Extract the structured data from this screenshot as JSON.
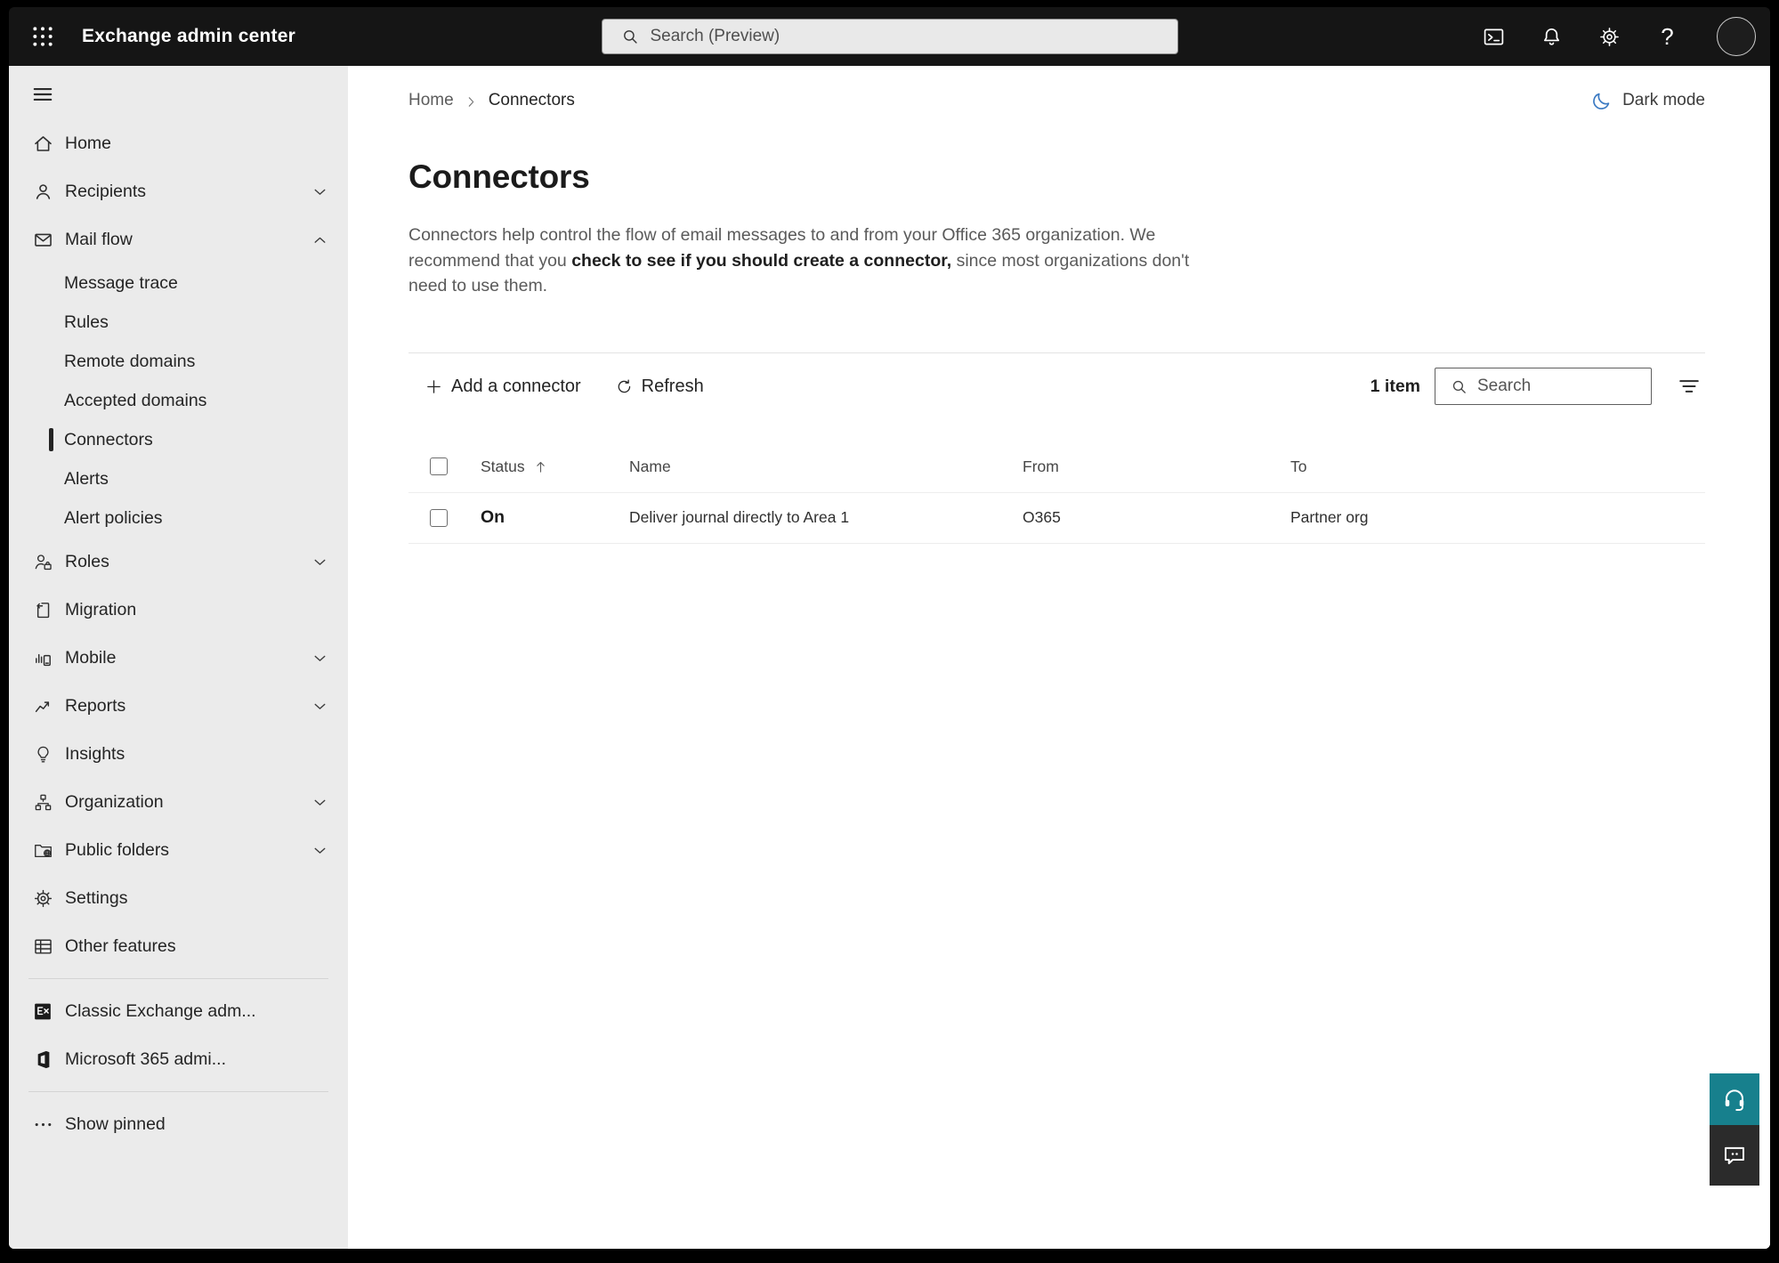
{
  "topbar": {
    "app_title": "Exchange admin center",
    "search_placeholder": "Search (Preview)"
  },
  "sidebar": {
    "items": [
      {
        "type": "item",
        "label": "Home",
        "icon": "home"
      },
      {
        "type": "item",
        "label": "Recipients",
        "icon": "recipients",
        "chevron": "down"
      },
      {
        "type": "item",
        "label": "Mail flow",
        "icon": "mail-flow",
        "chevron": "up"
      },
      {
        "type": "sub",
        "label": "Message trace"
      },
      {
        "type": "sub",
        "label": "Rules"
      },
      {
        "type": "sub",
        "label": "Remote domains"
      },
      {
        "type": "sub",
        "label": "Accepted domains"
      },
      {
        "type": "sub",
        "label": "Connectors",
        "selected": true
      },
      {
        "type": "sub",
        "label": "Alerts"
      },
      {
        "type": "sub",
        "label": "Alert policies"
      },
      {
        "type": "item",
        "label": "Roles",
        "icon": "roles",
        "chevron": "down"
      },
      {
        "type": "item",
        "label": "Migration",
        "icon": "migration"
      },
      {
        "type": "item",
        "label": "Mobile",
        "icon": "mobile",
        "chevron": "down"
      },
      {
        "type": "item",
        "label": "Reports",
        "icon": "reports",
        "chevron": "down"
      },
      {
        "type": "item",
        "label": "Insights",
        "icon": "insights"
      },
      {
        "type": "item",
        "label": "Organization",
        "icon": "organization",
        "chevron": "down"
      },
      {
        "type": "item",
        "label": "Public folders",
        "icon": "public-folders",
        "chevron": "down"
      },
      {
        "type": "item",
        "label": "Settings",
        "icon": "settings"
      },
      {
        "type": "item",
        "label": "Other features",
        "icon": "other-features"
      },
      {
        "type": "divider"
      },
      {
        "type": "item",
        "label": "Classic Exchange adm...",
        "icon": "classic-exchange"
      },
      {
        "type": "item",
        "label": "Microsoft 365 admi...",
        "icon": "microsoft-365"
      },
      {
        "type": "divider"
      },
      {
        "type": "item",
        "label": "Show pinned",
        "icon": "show-pinned"
      }
    ]
  },
  "breadcrumb": {
    "home": "Home",
    "current": "Connectors"
  },
  "dark_mode": {
    "label": "Dark mode"
  },
  "page": {
    "title": "Connectors",
    "description": {
      "pre": "Connectors help control the flow of email messages to and from your Office 365 organization. We recommend that you ",
      "emphasis": "check to see if you should create a connector,",
      "post": " since most organizations don't need to use them."
    }
  },
  "toolbar": {
    "add_label": "Add a connector",
    "refresh_label": "Refresh",
    "count": "1 item",
    "search_placeholder": "Search"
  },
  "table": {
    "columns": {
      "status": "Status",
      "name": "Name",
      "from": "From",
      "to": "To"
    },
    "sorted_column": "status",
    "sort_direction": "ascending",
    "rows": [
      {
        "status": "On",
        "name": "Deliver journal directly to Area 1",
        "from": "O365",
        "to": "Partner org"
      }
    ]
  },
  "colors": {
    "topbar_bg": "#151515",
    "sidebar_bg": "#ebebeb",
    "selected_indicator": "#242424",
    "dark_mode_moon": "#3a79c2",
    "support_teal": "#17808d",
    "feedback_dark": "#2b2b2b"
  }
}
